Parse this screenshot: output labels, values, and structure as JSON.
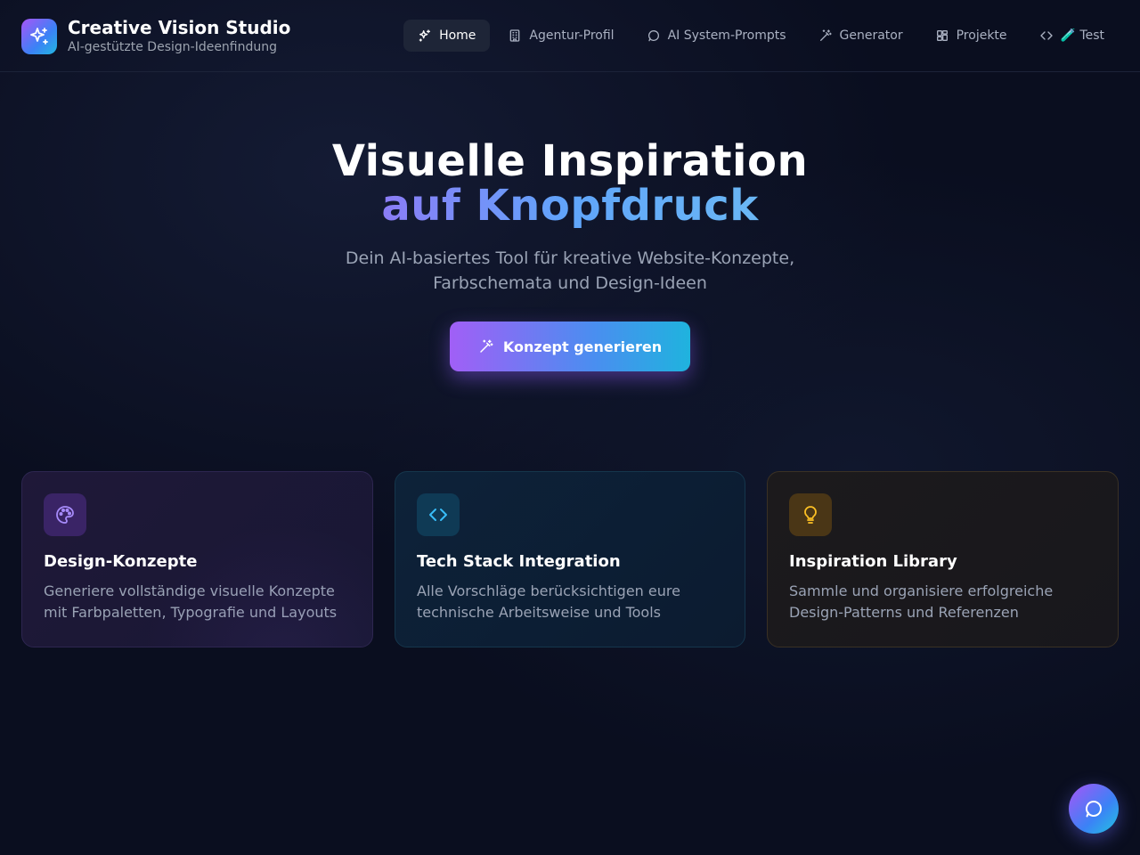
{
  "brand": {
    "title": "Creative Vision Studio",
    "subtitle": "AI-gestützte Design-Ideenfindung",
    "logo_icon": "sparkles-icon"
  },
  "nav": {
    "items": [
      {
        "label": "Home",
        "icon": "sparkles-icon",
        "active": true
      },
      {
        "label": "Agentur-Profil",
        "icon": "building-icon",
        "active": false
      },
      {
        "label": "AI System-Prompts",
        "icon": "message-circle-icon",
        "active": false
      },
      {
        "label": "Generator",
        "icon": "magic-wand-icon",
        "active": false
      },
      {
        "label": "Projekte",
        "icon": "layout-grid-icon",
        "active": false
      },
      {
        "label": "🧪 Test",
        "icon": "code-icon",
        "active": false
      }
    ]
  },
  "hero": {
    "line1": "Visuelle Inspiration",
    "line2": "auf Knopfdruck",
    "subtitle_line1": "Dein AI-basiertes Tool für kreative Website-Konzepte,",
    "subtitle_line2": "Farbschemata und Design-Ideen",
    "cta_label": "Konzept generieren"
  },
  "cards": [
    {
      "title": "Design-Konzepte",
      "desc_line1": "Generiere vollständige visuelle Konzepte",
      "desc_line2": "mit Farbpaletten, Typografie und Layouts",
      "icon": "palette-icon",
      "accent": "#a78bfa"
    },
    {
      "title": "Tech Stack Integration",
      "desc_line1": "Alle Vorschläge berücksichtigen eure",
      "desc_line2": "technische Arbeitsweise und Tools",
      "icon": "code-icon",
      "accent": "#38bdf8"
    },
    {
      "title": "Inspiration Library",
      "desc_line1": "Sammle und organisiere erfolgreiche",
      "desc_line2": "Design-Patterns und Referenzen",
      "icon": "lightbulb-icon",
      "accent": "#fbbf24"
    }
  ],
  "fab": {
    "icon": "chat-bubble-icon"
  },
  "colors": {
    "background": "#0a0e1f",
    "accent_purple": "#a855f7",
    "accent_blue": "#3b82f6",
    "accent_cyan": "#22b8e0"
  }
}
